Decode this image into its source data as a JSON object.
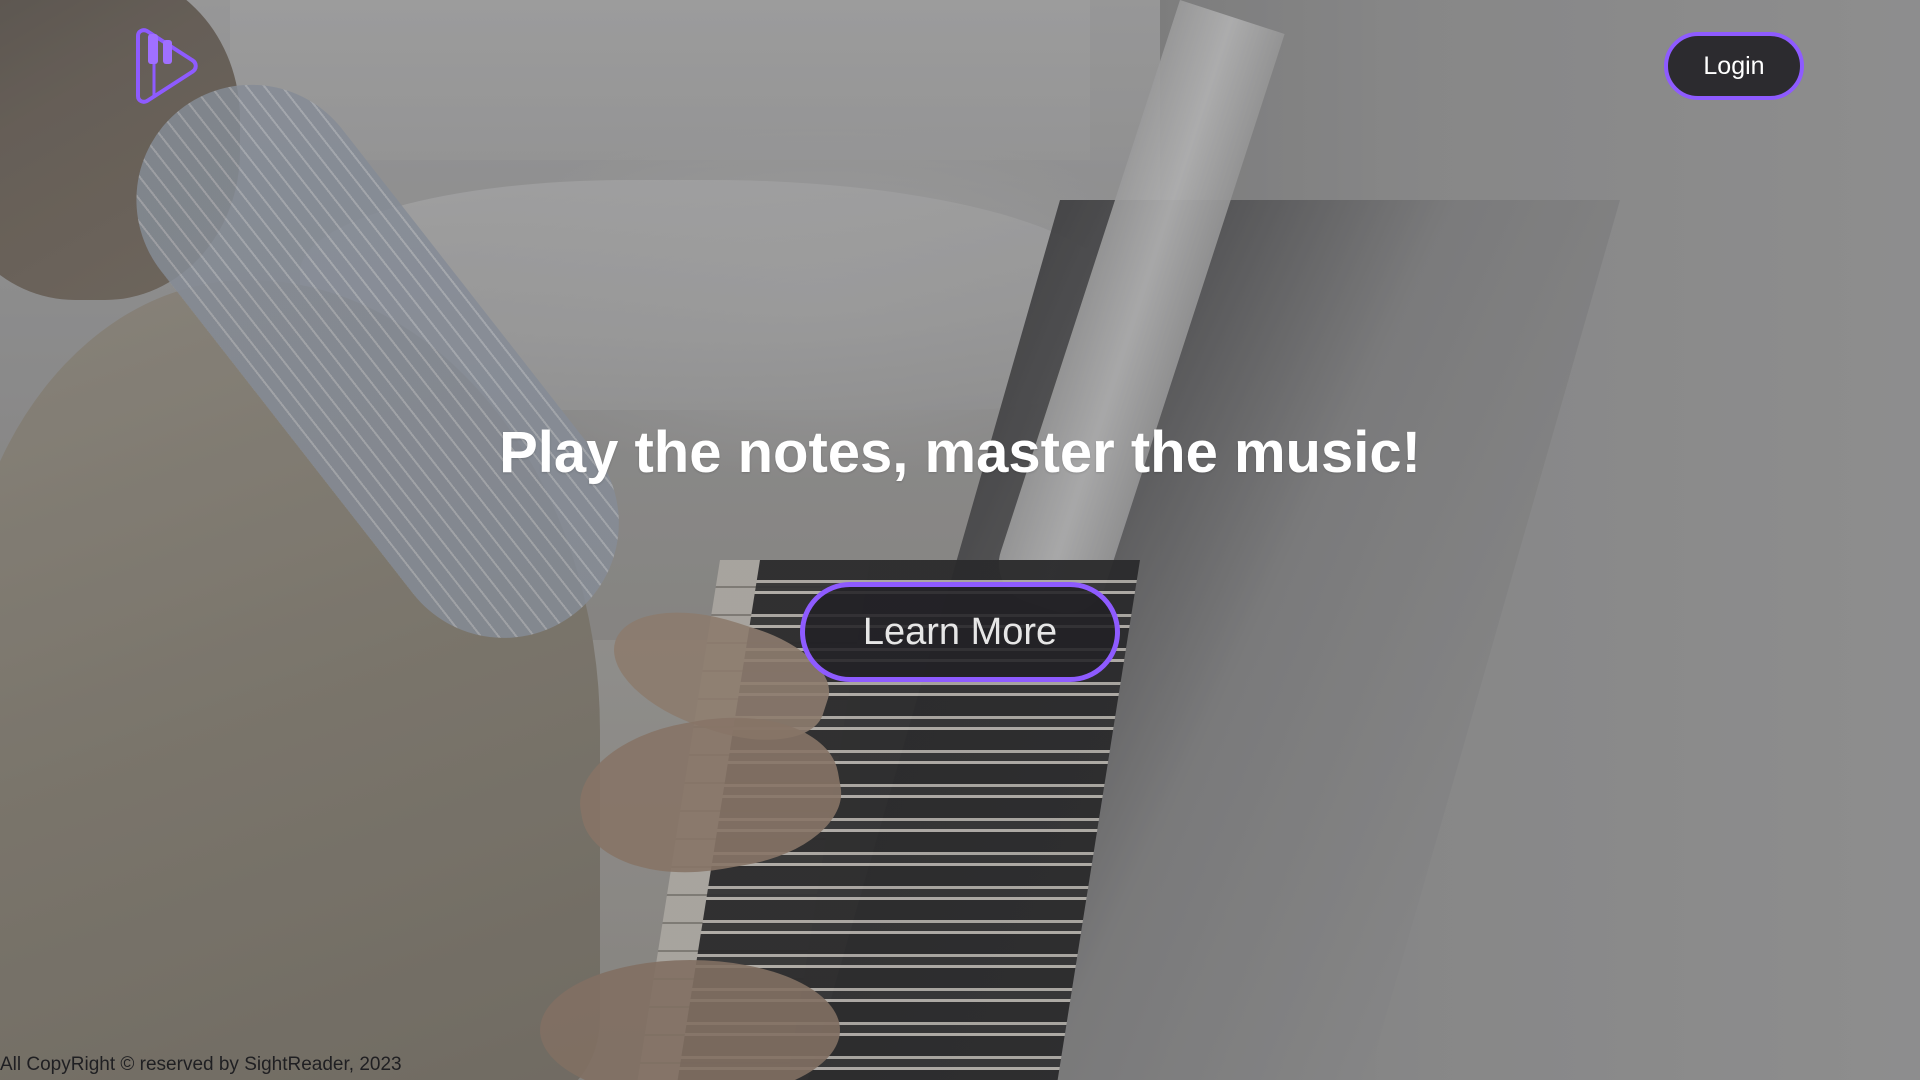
{
  "brand": {
    "logo_icon": "piano-play-logo-icon",
    "accent_color": "#8e5bff"
  },
  "header": {
    "login_label": "Login"
  },
  "hero": {
    "title": "Play the notes, master the music!",
    "cta_label": "Learn More",
    "background_image": "person-playing-piano-photo"
  },
  "footer": {
    "copyright": "All CopyRight © reserved by SightReader, 2023"
  }
}
